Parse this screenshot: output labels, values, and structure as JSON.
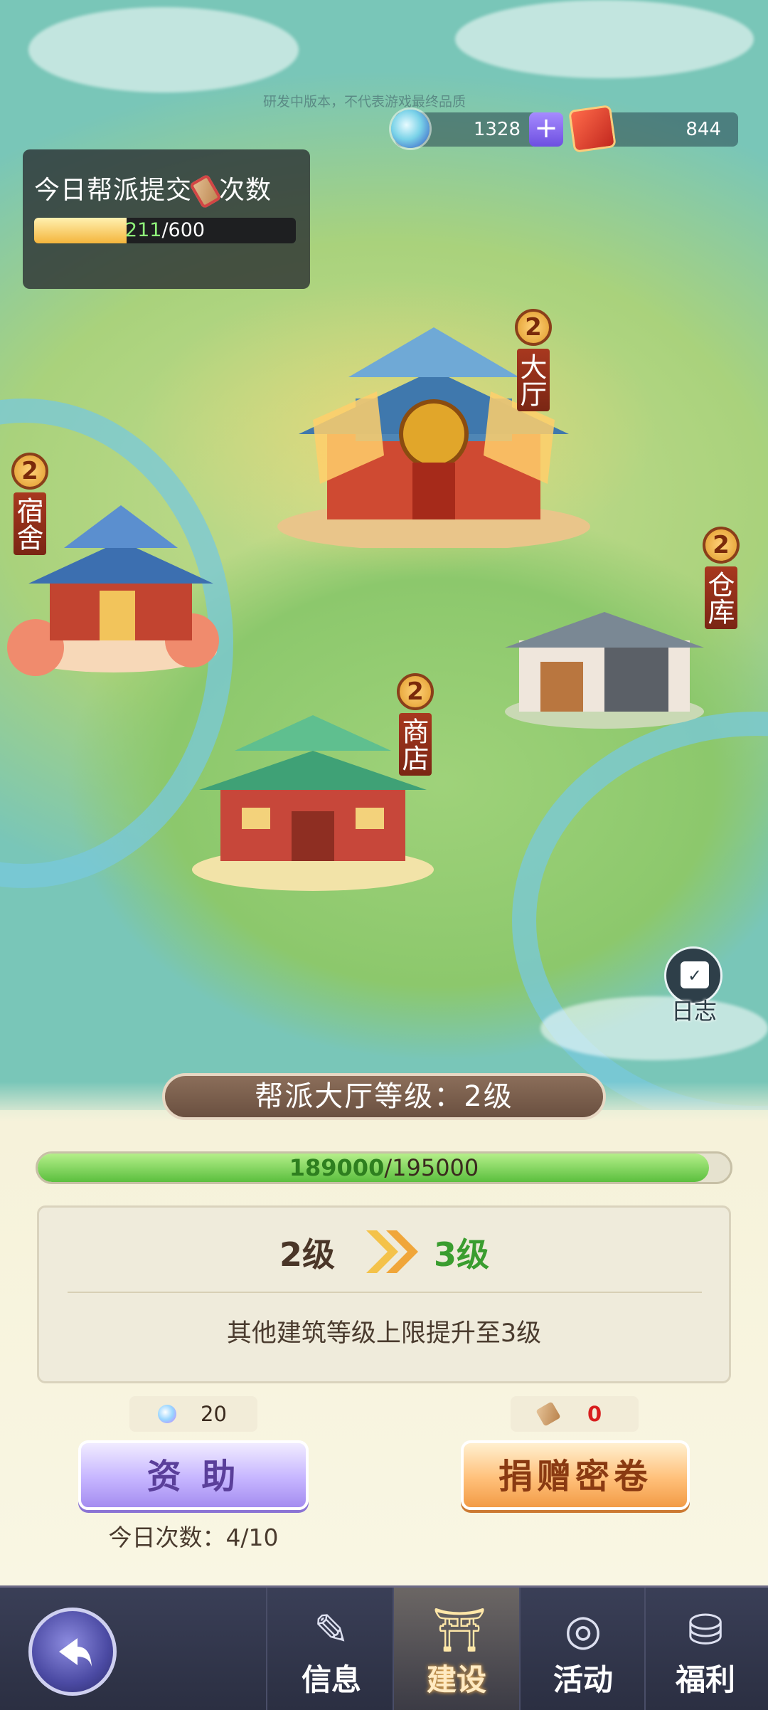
{
  "watermark": "研发中版本，不代表游戏最终品质",
  "currency": {
    "gem": {
      "value": "1328",
      "icon": "gem-icon"
    },
    "plus_label": "+",
    "book": {
      "value": "844",
      "icon": "fire-book-icon"
    }
  },
  "submit_panel": {
    "title_pre": "今日帮派提交",
    "title_post": "次数",
    "current": "211",
    "max": "/600",
    "progress": 0.352
  },
  "buildings": [
    {
      "level": "2",
      "name": "大厅"
    },
    {
      "level": "2",
      "name": "宿舍"
    },
    {
      "level": "2",
      "name": "仓库"
    },
    {
      "level": "2",
      "name": "商店"
    }
  ],
  "log": {
    "label": "日志"
  },
  "hall": {
    "level_text": "帮派大厅等级：2级"
  },
  "exp": {
    "current": "189000",
    "max": "/195000",
    "progress": 0.969
  },
  "upgrade": {
    "from": "2级",
    "to": "3级",
    "description": "其他建筑等级上限提升至3级"
  },
  "costs": {
    "donate": {
      "value": "20",
      "icon": "gem-icon"
    },
    "scroll": {
      "value": "0",
      "icon": "scroll-icon"
    }
  },
  "buttons": {
    "donate": "资 助",
    "scroll": "捐赠密卷"
  },
  "today_count": "今日次数：4/10",
  "nav": {
    "tabs": [
      {
        "label": "信息",
        "icon": "info-icon",
        "active": false
      },
      {
        "label": "建设",
        "icon": "build-icon",
        "active": true
      },
      {
        "label": "活动",
        "icon": "activity-icon",
        "active": false
      },
      {
        "label": "福利",
        "icon": "gift-chest-icon",
        "active": false
      }
    ]
  }
}
